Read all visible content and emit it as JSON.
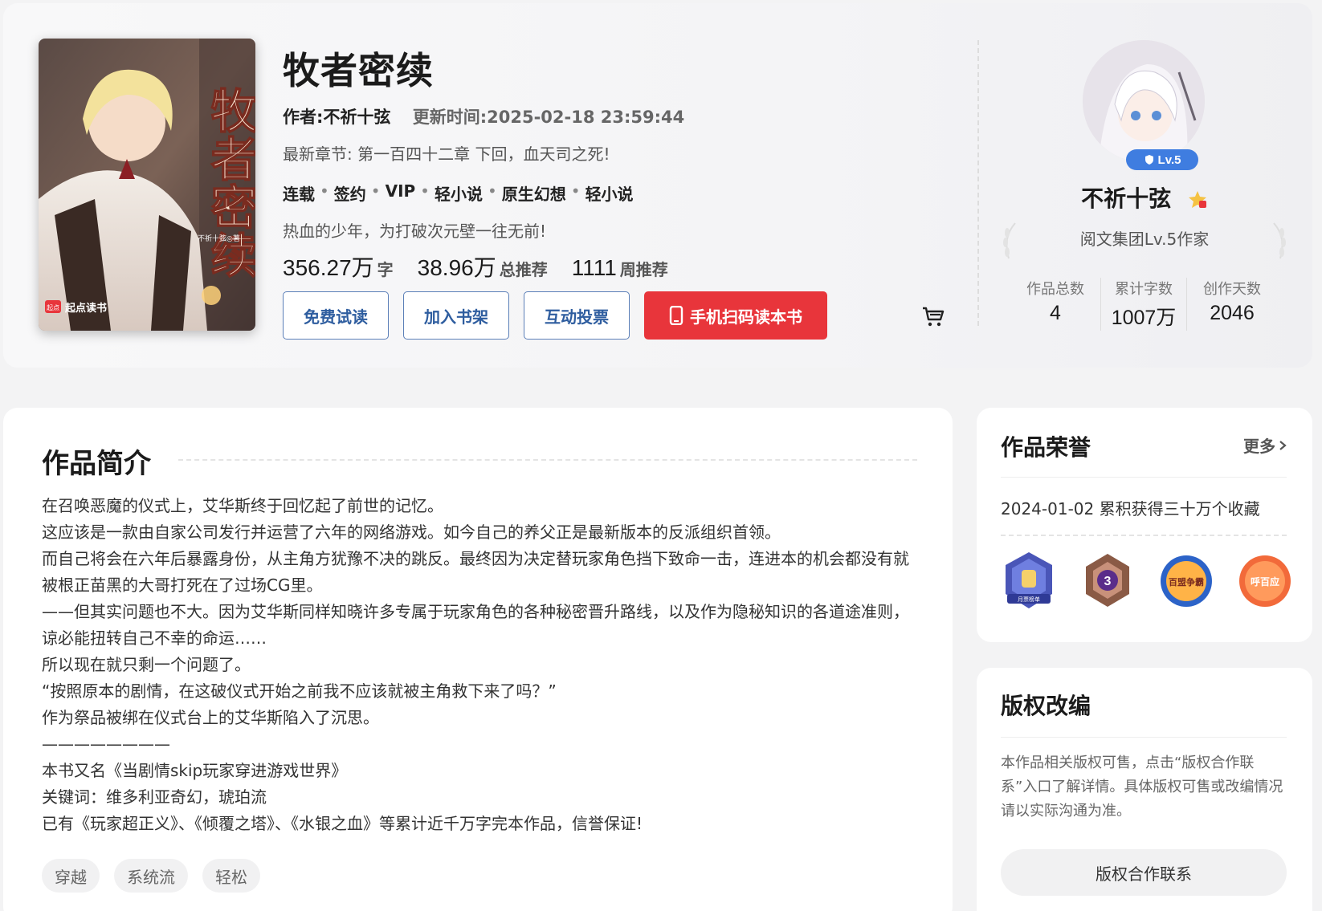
{
  "book": {
    "cover_title": "牧者密续",
    "cover_author": "不祈十弦◎著",
    "cover_brand": "起点读书",
    "cover_brand_mark": "起点",
    "title": "牧者密续",
    "author": "作者:不祈十弦",
    "update_time": "更新时间:2025-02-18 23:59:44",
    "latest_chapter": "最新章节: 第一百四十二章 下回，血天司之死!",
    "tags": [
      "连载",
      "签约",
      "VIP",
      "轻小说",
      "原生幻想",
      "轻小说"
    ],
    "slogan": "热血的少年，为打破次元壁一往无前!",
    "stats": [
      {
        "num": "356.27万",
        "unit": "字"
      },
      {
        "num": "38.96万",
        "unit": "总推荐"
      },
      {
        "num": "1111",
        "unit": "周推荐"
      }
    ]
  },
  "actions": {
    "trial": "免费试读",
    "shelf": "加入书架",
    "vote": "互动投票",
    "scan": "手机扫码读本书"
  },
  "author_panel": {
    "level": "Lv.5",
    "name": "不祈十弦",
    "title": "阅文集团Lv.5作家",
    "stats": [
      {
        "label": "作品总数",
        "value": "4"
      },
      {
        "label": "累计字数",
        "value": "1007万"
      },
      {
        "label": "创作天数",
        "value": "2046"
      }
    ]
  },
  "intro": {
    "heading": "作品简介",
    "paragraphs": [
      "在召唤恶魔的仪式上，艾华斯终于回忆起了前世的记忆。",
      "这应该是一款由自家公司发行并运营了六年的网络游戏。如今自己的养父正是最新版本的反派组织首领。",
      "而自己将会在六年后暴露身份，从主角方犹豫不决的跳反。最终因为决定替玩家角色挡下致命一击，连进本的机会都没有就被根正苗黑的大哥打死在了过场CG里。",
      "——但其实问题也不大。因为艾华斯同样知晓许多专属于玩家角色的各种秘密晋升路线，以及作为隐秘知识的各道途准则，谅必能扭转自己不幸的命运……",
      "所以现在就只剩一个问题了。",
      "“按照原本的剧情，在这破仪式开始之前我不应该就被主角救下来了吗？”",
      "作为祭品被绑在仪式台上的艾华斯陷入了沉思。",
      "————————",
      "本书又名《当剧情skip玩家穿进游戏世界》",
      "关键词：维多利亚奇幻，琥珀流",
      "已有《玩家超正义》、《倾覆之塔》、《水银之血》等累计近千万字完本作品，信誉保证!"
    ],
    "tags": [
      "穿越",
      "系统流",
      "轻松"
    ]
  },
  "honor": {
    "heading": "作品荣誉",
    "more": "更多",
    "item": "2024-01-02 累积获得三十万个收藏",
    "badge_texts": [
      "月票榜单",
      "3",
      "百盟争霸",
      "呼百应"
    ]
  },
  "rights": {
    "heading": "版权改编",
    "text": "本作品相关版权可售，点击“版权合作联系”入口了解详情。具体版权可售或改编情况请以实际沟通为准。",
    "button": "版权合作联系"
  }
}
